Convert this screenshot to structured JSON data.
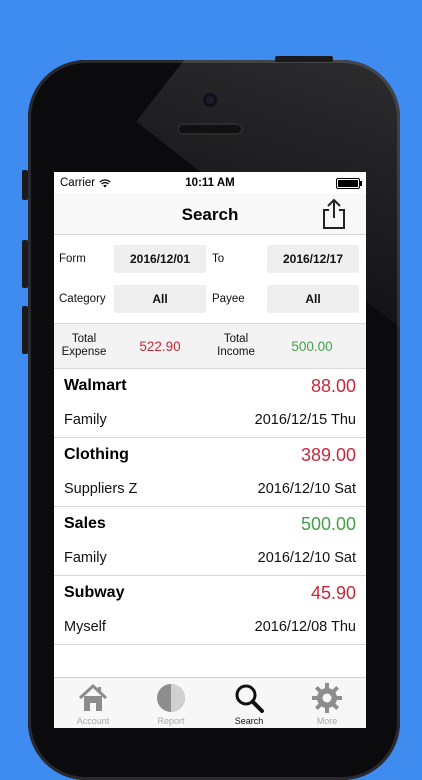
{
  "status_bar": {
    "carrier": "Carrier",
    "time": "10:11 AM"
  },
  "nav": {
    "title": "Search"
  },
  "filters": {
    "from_label": "Form",
    "from_value": "2016/12/01",
    "to_label": "To",
    "to_value": "2016/12/17",
    "category_label": "Category",
    "category_value": "All",
    "payee_label": "Payee",
    "payee_value": "All"
  },
  "totals": {
    "expense_label_1": "Total",
    "expense_label_2": "Expense",
    "expense_value": "522.90",
    "income_label_1": "Total",
    "income_label_2": "Income",
    "income_value": "500.00"
  },
  "entries": [
    {
      "name": "Walmart",
      "amount": "88.00",
      "type": "expense",
      "category": "Family",
      "date": "2016/12/15 Thu"
    },
    {
      "name": "Clothing",
      "amount": "389.00",
      "type": "expense",
      "category": "Suppliers Z",
      "date": "2016/12/10 Sat"
    },
    {
      "name": "Sales",
      "amount": "500.00",
      "type": "income",
      "category": "Family",
      "date": "2016/12/10 Sat"
    },
    {
      "name": "Subway",
      "amount": "45.90",
      "type": "expense",
      "category": "Myself",
      "date": "2016/12/08 Thu"
    }
  ],
  "tabs": [
    {
      "label": "Account",
      "icon": "house-icon",
      "active": false
    },
    {
      "label": "Report",
      "icon": "pie-chart-icon",
      "active": false
    },
    {
      "label": "Search",
      "icon": "magnifier-icon",
      "active": true
    },
    {
      "label": "More",
      "icon": "gear-icon",
      "active": false
    }
  ],
  "colors": {
    "background": "#3f8cf0",
    "expense": "#c8283a",
    "income": "#43a047"
  }
}
